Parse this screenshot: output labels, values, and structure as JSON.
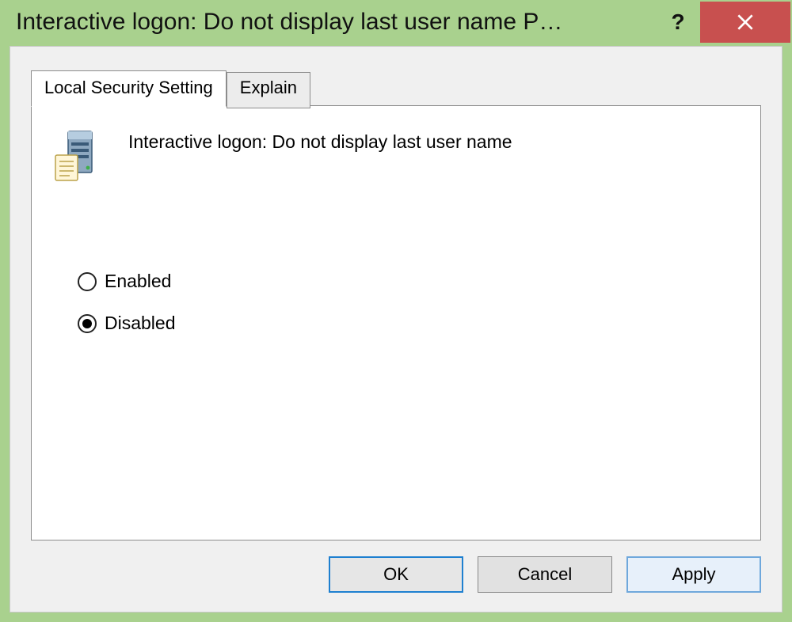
{
  "window": {
    "title": "Interactive logon: Do not display last user name P…"
  },
  "tabs": {
    "local_security": "Local Security Setting",
    "explain": "Explain"
  },
  "policy": {
    "label": "Interactive logon: Do not display last user name"
  },
  "options": {
    "enabled": "Enabled",
    "disabled": "Disabled",
    "selected": "disabled"
  },
  "buttons": {
    "ok": "OK",
    "cancel": "Cancel",
    "apply": "Apply"
  }
}
